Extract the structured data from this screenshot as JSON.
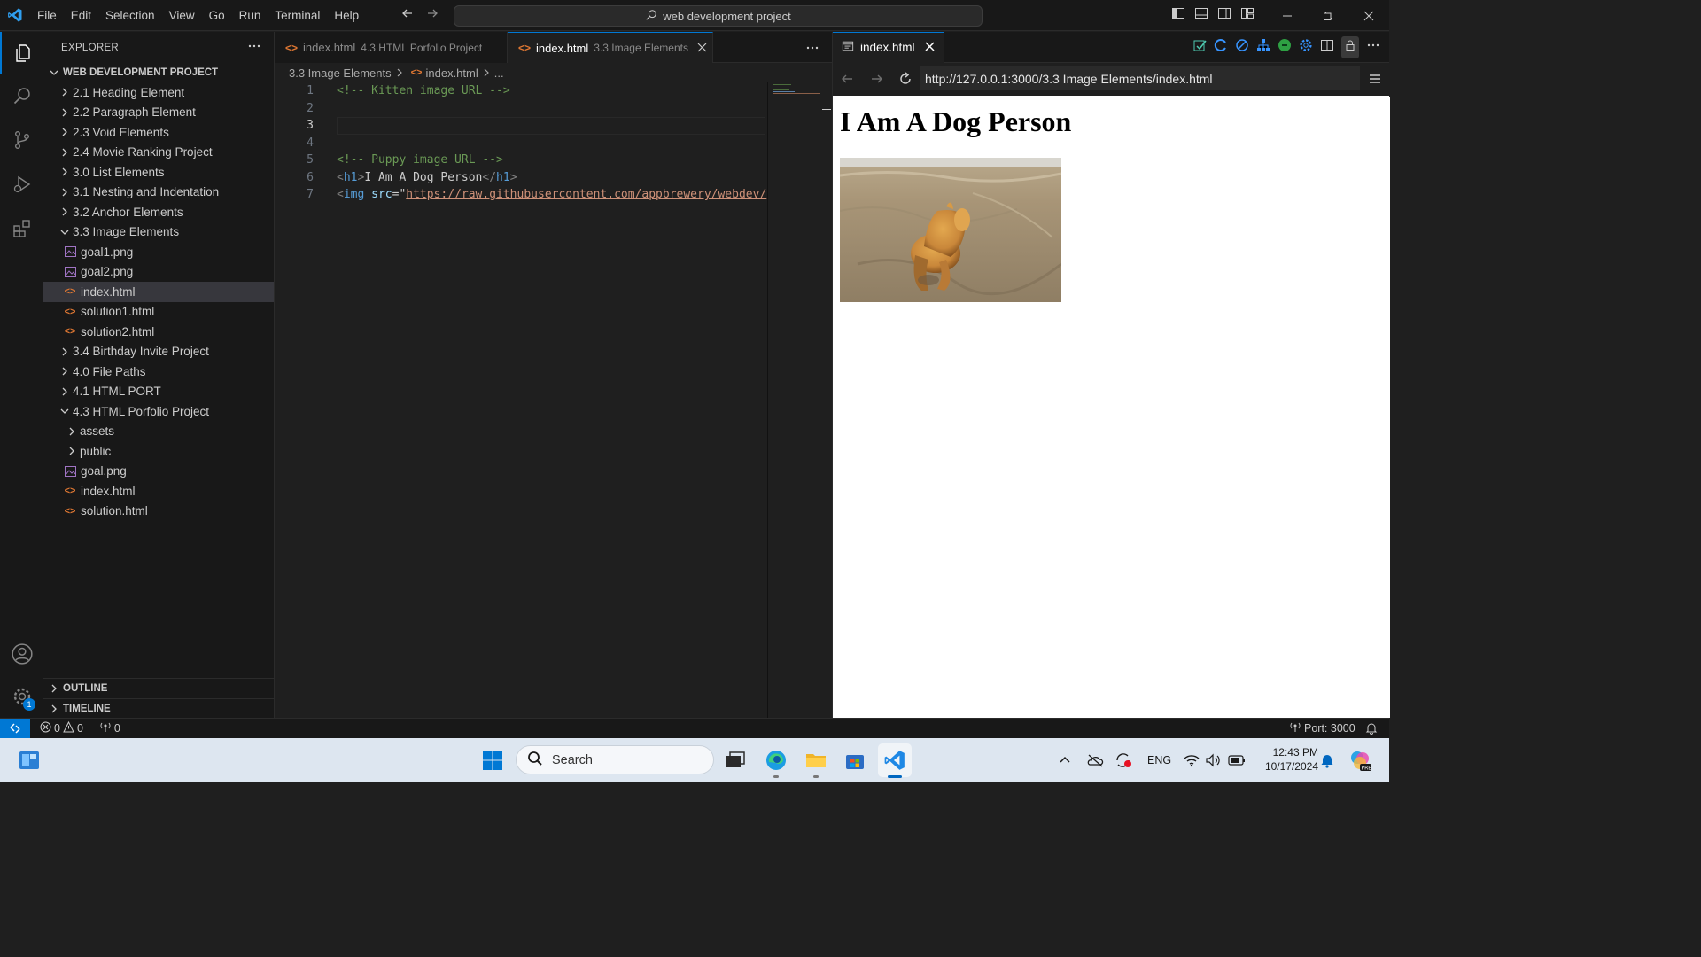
{
  "titlebar": {
    "menu": [
      "File",
      "Edit",
      "Selection",
      "View",
      "Go",
      "Run",
      "Terminal",
      "Help"
    ],
    "search_text": "web development project"
  },
  "sidebar": {
    "title": "EXPLORER",
    "root": "WEB DEVELOPMENT PROJECT",
    "tree": [
      {
        "label": "2.1 Heading Element",
        "type": "folder",
        "open": false,
        "depth": 0
      },
      {
        "label": "2.2 Paragraph Element",
        "type": "folder",
        "open": false,
        "depth": 0
      },
      {
        "label": "2.3 Void Elements",
        "type": "folder",
        "open": false,
        "depth": 0
      },
      {
        "label": "2.4 Movie Ranking Project",
        "type": "folder",
        "open": false,
        "depth": 0
      },
      {
        "label": "3.0 List Elements",
        "type": "folder",
        "open": false,
        "depth": 0
      },
      {
        "label": "3.1 Nesting and Indentation",
        "type": "folder",
        "open": false,
        "depth": 0
      },
      {
        "label": "3.2 Anchor Elements",
        "type": "folder",
        "open": false,
        "depth": 0
      },
      {
        "label": "3.3 Image Elements",
        "type": "folder",
        "open": true,
        "depth": 0
      },
      {
        "label": "goal1.png",
        "type": "image",
        "depth": 1
      },
      {
        "label": "goal2.png",
        "type": "image",
        "depth": 1
      },
      {
        "label": "index.html",
        "type": "html",
        "depth": 1,
        "selected": true
      },
      {
        "label": "solution1.html",
        "type": "html",
        "depth": 1
      },
      {
        "label": "solution2.html",
        "type": "html",
        "depth": 1
      },
      {
        "label": "3.4 Birthday Invite Project",
        "type": "folder",
        "open": false,
        "depth": 0
      },
      {
        "label": "4.0 File Paths",
        "type": "folder",
        "open": false,
        "depth": 0
      },
      {
        "label": "4.1 HTML PORT",
        "type": "folder",
        "open": false,
        "depth": 0
      },
      {
        "label": "4.3 HTML Porfolio Project",
        "type": "folder",
        "open": true,
        "depth": 0
      },
      {
        "label": "assets",
        "type": "folder",
        "open": false,
        "depth": 1
      },
      {
        "label": "public",
        "type": "folder",
        "open": false,
        "depth": 1
      },
      {
        "label": "goal.png",
        "type": "image",
        "depth": 1
      },
      {
        "label": "index.html",
        "type": "html",
        "depth": 1
      },
      {
        "label": "solution.html",
        "type": "html",
        "depth": 1
      }
    ],
    "outline": "OUTLINE",
    "timeline": "TIMELINE",
    "settings_badge": "1"
  },
  "editor": {
    "tabs": [
      {
        "name": "index.html",
        "desc": "4.3 HTML Porfolio Project",
        "active": false
      },
      {
        "name": "index.html",
        "desc": "3.3 Image Elements",
        "active": true
      }
    ],
    "breadcrumb": [
      "3.3 Image Elements",
      "index.html",
      "..."
    ],
    "lines": [
      {
        "n": "1",
        "parts": [
          {
            "c": "c-comment",
            "t": "<!-- Kitten image URL -->"
          }
        ]
      },
      {
        "n": "2",
        "parts": []
      },
      {
        "n": "3",
        "parts": [],
        "current": true
      },
      {
        "n": "4",
        "parts": []
      },
      {
        "n": "5",
        "parts": [
          {
            "c": "c-comment",
            "t": "<!-- Puppy image URL -->"
          }
        ]
      },
      {
        "n": "6",
        "parts": [
          {
            "c": "c-punct",
            "t": "<"
          },
          {
            "c": "c-tag",
            "t": "h1"
          },
          {
            "c": "c-punct",
            "t": ">"
          },
          {
            "c": "c-text",
            "t": "I Am A Dog Person"
          },
          {
            "c": "c-punct",
            "t": "</"
          },
          {
            "c": "c-tag",
            "t": "h1"
          },
          {
            "c": "c-punct",
            "t": ">"
          }
        ]
      },
      {
        "n": "7",
        "parts": [
          {
            "c": "c-punct",
            "t": "<"
          },
          {
            "c": "c-tag",
            "t": "img"
          },
          {
            "c": "c-text",
            "t": " "
          },
          {
            "c": "c-attr",
            "t": "src"
          },
          {
            "c": "c-text",
            "t": "=\""
          },
          {
            "c": "c-str",
            "t": "https://raw.githubusercontent.com/appbrewery/webdev/"
          }
        ]
      }
    ]
  },
  "preview": {
    "tab": "index.html",
    "url": "http://127.0.0.1:3000/3.3 Image Elements/index.html",
    "heading": "I Am A Dog Person"
  },
  "statusbar": {
    "errors": "0",
    "warnings": "0",
    "ports": "0",
    "port_label": "Port: 3000"
  },
  "taskbar": {
    "search_placeholder": "Search",
    "lang": "ENG",
    "time": "12:43 PM",
    "date": "10/17/2024"
  },
  "colors": {
    "accent": "#0078d4",
    "editor_bg": "#1f1f1f",
    "sidebar_bg": "#181818",
    "selection_bg": "#37373d",
    "comment": "#6a9955",
    "tag": "#569cd6",
    "string": "#ce9178"
  }
}
